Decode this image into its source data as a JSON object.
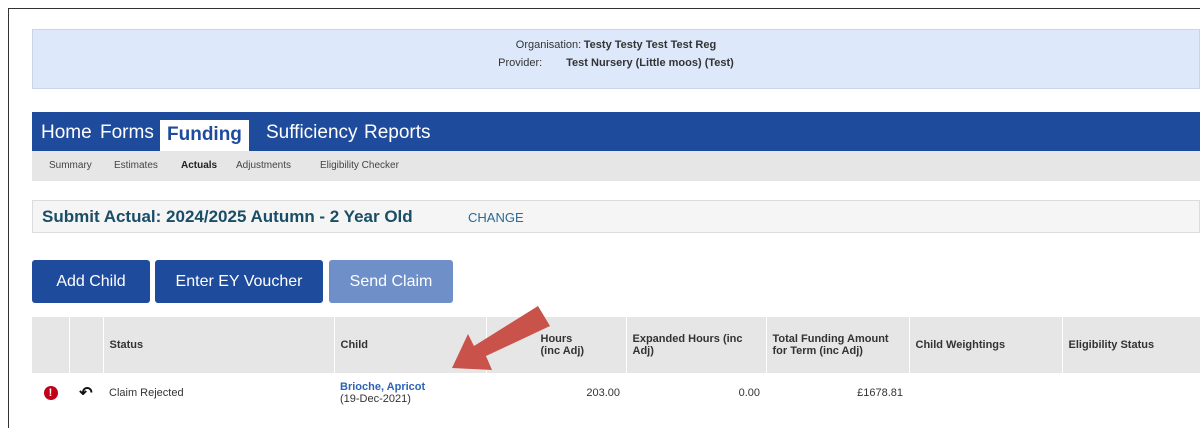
{
  "info": {
    "org_label": "Organisation:",
    "org_value": "Testy Testy Test Test Reg",
    "provider_label": "Provider:",
    "provider_value": "Test Nursery (Little moos) (Test)"
  },
  "nav": {
    "items": [
      {
        "label": "Home"
      },
      {
        "label": "Forms"
      },
      {
        "label": "Funding"
      },
      {
        "label": "Sufficiency"
      },
      {
        "label": "Reports"
      }
    ],
    "active": "Funding"
  },
  "subnav": {
    "items": [
      {
        "label": "Summary"
      },
      {
        "label": "Estimates"
      },
      {
        "label": "Actuals"
      },
      {
        "label": "Adjustments"
      },
      {
        "label": "Eligibility Checker"
      }
    ],
    "active": "Actuals"
  },
  "heading": {
    "title": "Submit Actual: 2024/2025 Autumn - 2 Year Old",
    "change": "CHANGE"
  },
  "buttons": {
    "add_child": "Add Child",
    "enter_voucher": "Enter EY Voucher",
    "send_claim": "Send Claim"
  },
  "table": {
    "headers": {
      "status": "Status",
      "child": "Child",
      "hours": "Hours",
      "hours_sub": "(inc Adj)",
      "expanded": "Expanded Hours (inc Adj)",
      "total": "Total Funding Amount for Term (inc Adj)",
      "weightings": "Child Weightings",
      "eligibility": "Eligibility Status"
    },
    "rows": [
      {
        "error_icon": "!",
        "undo_icon": "↶",
        "status": "Claim Rejected",
        "child_name": "Brioche, Apricot",
        "child_dob": "(19-Dec-2021)",
        "hours": "203.00",
        "expanded": "0.00",
        "total": "£1678.81",
        "weightings": "",
        "eligibility": ""
      }
    ]
  },
  "colors": {
    "nav_bg": "#1e4b9c",
    "info_bg": "#dde9fb",
    "error_red": "#c0001a",
    "arrow_red": "#c9534a"
  }
}
